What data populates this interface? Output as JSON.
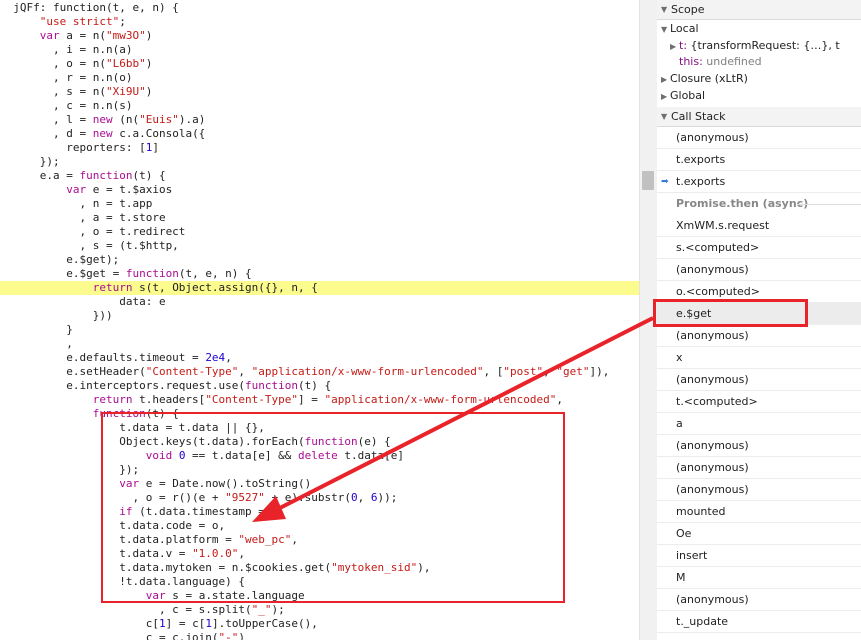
{
  "code_lines": [
    [
      [
        "",
        "  jQFf: function(t, e, n) {"
      ]
    ],
    [
      [
        "s",
        "      \"use strict\""
      ],
      [
        "",
        ";"
      ]
    ],
    [
      [
        "k",
        "      var"
      ],
      [
        "",
        " a = n("
      ],
      [
        "s",
        "\"mw3O\""
      ],
      [
        "",
        ")"
      ]
    ],
    [
      [
        "",
        "        , i = n.n(a)"
      ]
    ],
    [
      [
        "",
        "        , o = n("
      ],
      [
        "s",
        "\"L6bb\""
      ],
      [
        "",
        ")"
      ]
    ],
    [
      [
        "",
        "        , r = n.n(o)"
      ]
    ],
    [
      [
        "",
        "        , s = n("
      ],
      [
        "s",
        "\"Xi9U\""
      ],
      [
        "",
        ")"
      ]
    ],
    [
      [
        "",
        "        , c = n.n(s)"
      ]
    ],
    [
      [
        "",
        "        , l = "
      ],
      [
        "k",
        "new"
      ],
      [
        "",
        " (n("
      ],
      [
        "s",
        "\"Euis\""
      ],
      [
        "",
        ").a)"
      ]
    ],
    [
      [
        "",
        "        , d = "
      ],
      [
        "k",
        "new"
      ],
      [
        "",
        " c.a.Consola({"
      ]
    ],
    [
      [
        "",
        "          reporters: ["
      ],
      [
        "n",
        "1"
      ],
      [
        "",
        "]"
      ]
    ],
    [
      [
        "",
        "      });"
      ]
    ],
    [
      [
        "",
        "      e.a = "
      ],
      [
        "k",
        "function"
      ],
      [
        "",
        "(t) {"
      ]
    ],
    [
      [
        "k",
        "          var"
      ],
      [
        "",
        " e = t.$axios"
      ]
    ],
    [
      [
        "",
        "            , n = t.app"
      ]
    ],
    [
      [
        "",
        "            , a = t.store"
      ]
    ],
    [
      [
        "",
        "            , o = t.redirect"
      ]
    ],
    [
      [
        "",
        "            , s = (t.$http,"
      ]
    ],
    [
      [
        "",
        "          e.$get);"
      ]
    ],
    [
      [
        "",
        "          e.$get = "
      ],
      [
        "k",
        "function"
      ],
      [
        "",
        "(t, e, n) {"
      ]
    ],
    [
      [
        "k",
        "              return"
      ],
      [
        "",
        " s(t, Object.assign({}, n, {"
      ]
    ],
    [
      [
        "",
        "                  data: e"
      ]
    ],
    [
      [
        "",
        "              }))"
      ]
    ],
    [
      [
        "",
        "          }"
      ]
    ],
    [
      [
        "",
        "          ,"
      ]
    ],
    [
      [
        "",
        "          e.defaults.timeout = "
      ],
      [
        "n",
        "2e4"
      ],
      [
        "",
        ","
      ]
    ],
    [
      [
        "",
        "          e.setHeader("
      ],
      [
        "s",
        "\"Content-Type\""
      ],
      [
        "",
        ", "
      ],
      [
        "s",
        "\"application/x-www-form-urlencoded\""
      ],
      [
        "",
        ", ["
      ],
      [
        "s",
        "\"post\""
      ],
      [
        "",
        ", "
      ],
      [
        "s",
        "\"get\""
      ],
      [
        "",
        "]),"
      ]
    ],
    [
      [
        "",
        "          e.interceptors.request.use("
      ],
      [
        "k",
        "function"
      ],
      [
        "",
        "(t) {"
      ]
    ],
    [
      [
        "k",
        "              return"
      ],
      [
        "",
        " t.headers["
      ],
      [
        "s",
        "\"Content-Type\""
      ],
      [
        "",
        "] = "
      ],
      [
        "s",
        "\"application/x-www-form-urlencoded\""
      ],
      [
        "",
        ","
      ]
    ],
    [
      [
        "",
        "              "
      ],
      [
        "k",
        "function"
      ],
      [
        "",
        "(t) {"
      ]
    ],
    [
      [
        "",
        "                  t.data = t.data || {},"
      ]
    ],
    [
      [
        "",
        "                  Object.keys(t.data).forEach("
      ],
      [
        "k",
        "function"
      ],
      [
        "",
        "(e) {"
      ]
    ],
    [
      [
        "k",
        "                      void"
      ],
      [
        "",
        " "
      ],
      [
        "n",
        "0"
      ],
      [
        "",
        " == t.data[e] && "
      ],
      [
        "k",
        "delete"
      ],
      [
        "",
        " t.data[e]"
      ]
    ],
    [
      [
        "",
        "                  });"
      ]
    ],
    [
      [
        "k",
        "                  var"
      ],
      [
        "",
        " e = Date.now().toString()"
      ]
    ],
    [
      [
        "",
        "                    , o = r()(e + "
      ],
      [
        "s",
        "\"9527\""
      ],
      [
        "",
        " + e).substr("
      ],
      [
        "n",
        "0"
      ],
      [
        "",
        ", "
      ],
      [
        "n",
        "6"
      ],
      [
        "",
        "));"
      ]
    ],
    [
      [
        "k",
        "                  if"
      ],
      [
        "",
        " (t.data.timestamp = e,"
      ]
    ],
    [
      [
        "",
        "                  t.data.code = o,"
      ]
    ],
    [
      [
        "",
        "                  t.data.platform = "
      ],
      [
        "s",
        "\"web_pc\""
      ],
      [
        "",
        ","
      ]
    ],
    [
      [
        "",
        "                  t.data.v = "
      ],
      [
        "s",
        "\"1.0.0\""
      ],
      [
        "",
        ","
      ]
    ],
    [
      [
        "",
        "                  t.data.mytoken = n.$cookies.get("
      ],
      [
        "s",
        "\"mytoken_sid\""
      ],
      [
        "",
        "),"
      ]
    ],
    [
      [
        "",
        "                  !t.data.language) {"
      ]
    ],
    [
      [
        "k",
        "                      var"
      ],
      [
        "",
        " s = a.state.language"
      ]
    ],
    [
      [
        "",
        "                        , c = s.split("
      ],
      [
        "s",
        "\"_\""
      ],
      [
        "",
        ");"
      ]
    ],
    [
      [
        "",
        "                      c["
      ],
      [
        "n",
        "1"
      ],
      [
        "",
        "] = c["
      ],
      [
        "n",
        "1"
      ],
      [
        "",
        "].toUpperCase(),"
      ]
    ],
    [
      [
        "",
        "                      c = c.join("
      ],
      [
        "s",
        "\"-\""
      ],
      [
        "",
        ")"
      ]
    ]
  ],
  "highlighted_line_index": 20,
  "sidebar": {
    "scope": {
      "title": "Scope",
      "local_label": "Local",
      "t_key": "t:",
      "t_value": "{transformRequest: {…}, t",
      "this_key": "this:",
      "this_value": "undefined",
      "closure_label": "Closure (xLtR)",
      "global_label": "Global"
    },
    "call_stack": {
      "title": "Call Stack",
      "frames": [
        "(anonymous)",
        "t.exports",
        "t.exports",
        "Promise.then (async)",
        "XmWM.s.request",
        "s.<computed>",
        "(anonymous)",
        "o.<computed>",
        "e.$get",
        "(anonymous)",
        "x",
        "(anonymous)",
        "t.<computed>",
        "a",
        "(anonymous)",
        "(anonymous)",
        "(anonymous)",
        "mounted",
        "Oe",
        "insert",
        "M",
        "(anonymous)",
        "t._update"
      ],
      "current_frame_index": 2,
      "async_frame_index": 3,
      "selected_frame_index": 8
    }
  },
  "colors": {
    "annotation_red": "#e8242a",
    "highlight_yellow": "#fbfb8e",
    "keyword": "#aa0d91",
    "string": "#c41a16",
    "number": "#1c00cf",
    "current_frame_arrow": "#3879d9"
  },
  "icons": {
    "expand": "triangle-right-icon",
    "collapse": "triangle-down-icon",
    "current_frame": "current-frame-arrow-icon"
  }
}
